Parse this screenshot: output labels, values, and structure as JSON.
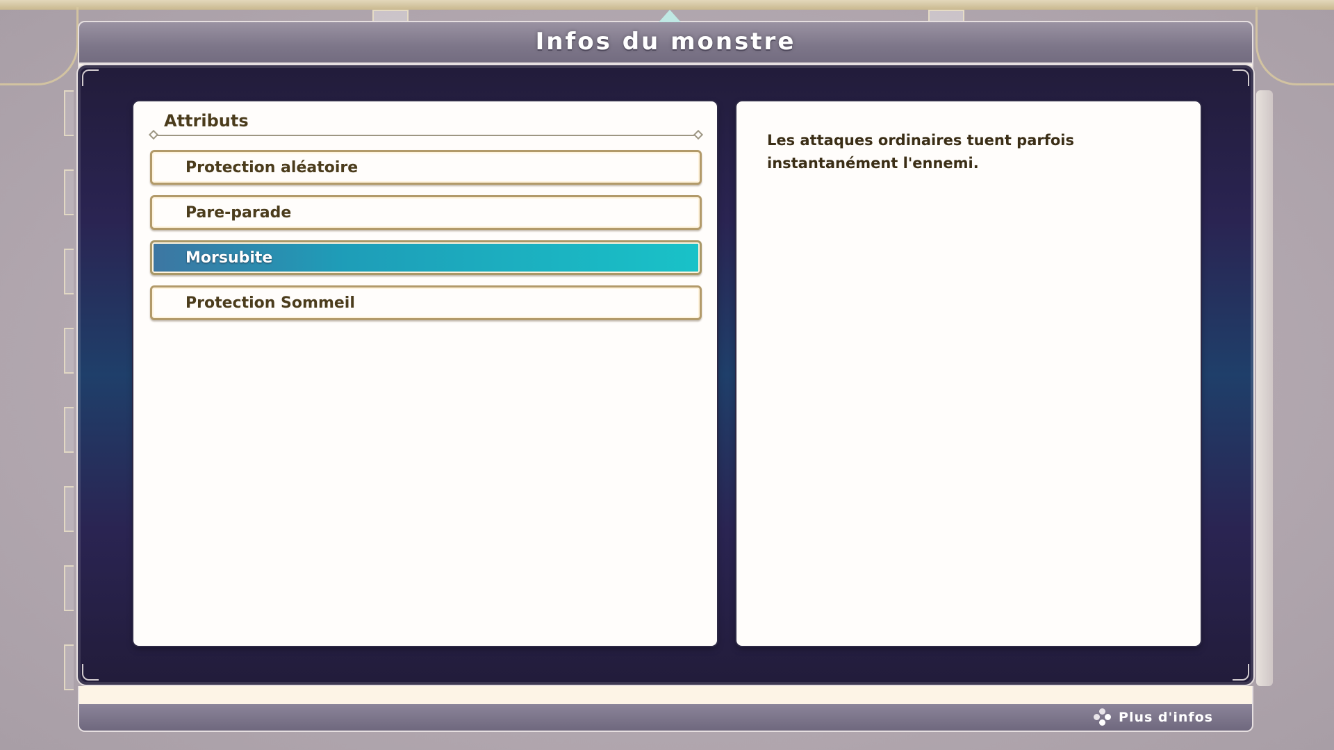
{
  "window": {
    "title": "Infos du monstre"
  },
  "attributes": {
    "section_title": "Attributs",
    "items": [
      {
        "label": "Protection aléatoire",
        "selected": false
      },
      {
        "label": "Pare-parade",
        "selected": false
      },
      {
        "label": "Morsubite",
        "selected": true
      },
      {
        "label": "Protection Sommeil",
        "selected": false
      }
    ]
  },
  "description": {
    "text": "Les attaques ordinaires tuent parfois instantanément l'ennemi."
  },
  "footer": {
    "hint_icon": "dpad-icon",
    "hint_label": "Plus d'infos"
  },
  "colors": {
    "selected_start": "#3d76a2",
    "selected_end": "#19c2c8",
    "text_brown": "#4b3c1c",
    "panel_dark": "#221c3a"
  }
}
